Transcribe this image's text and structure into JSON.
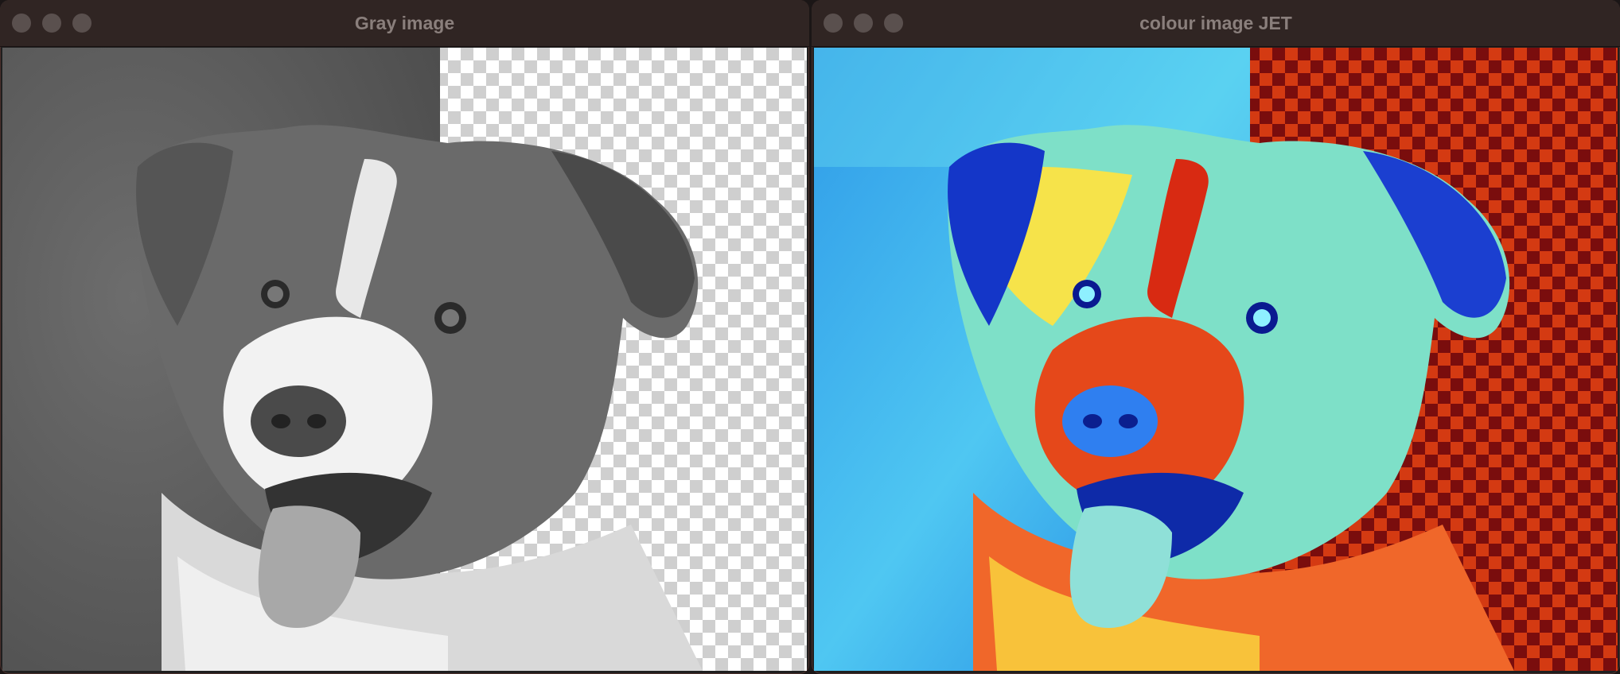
{
  "windows": [
    {
      "title": "Gray image"
    },
    {
      "title": "colour image JET"
    }
  ],
  "icons": {
    "close": "close-icon",
    "minimize": "minimize-icon",
    "zoom": "zoom-icon"
  },
  "colors": {
    "titlebar": "#302523",
    "title_text": "#8a7f7c",
    "traffic_inactive": "#5a504e",
    "jet_red": "#d43a12",
    "jet_dark_red": "#7a0d0d",
    "jet_blue": "#1b8be0",
    "jet_cyan": "#6ff0f0"
  }
}
